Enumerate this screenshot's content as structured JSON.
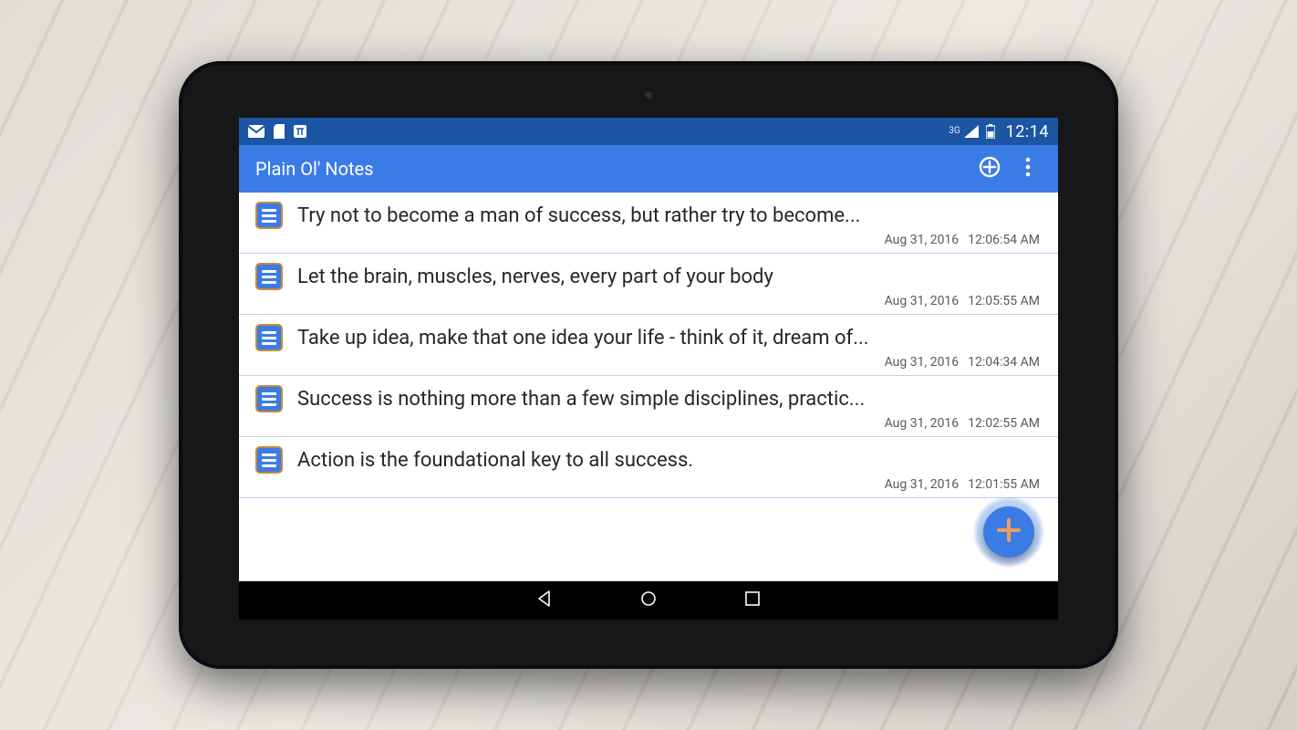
{
  "statusbar": {
    "network_label": "3G",
    "time": "12:14"
  },
  "appbar": {
    "title": "Plain Ol' Notes"
  },
  "notes": [
    {
      "title": "Try not to become a man of success, but rather try to become...",
      "date": "Aug 31, 2016",
      "time": "12:06:54 AM"
    },
    {
      "title": "Let the brain, muscles, nerves, every part of your body",
      "date": "Aug 31, 2016",
      "time": "12:05:55 AM"
    },
    {
      "title": "Take up idea, make that one idea your life -  think of it, dream of...",
      "date": "Aug 31, 2016",
      "time": "12:04:34 AM"
    },
    {
      "title": "Success is nothing more than a few simple disciplines, practic...",
      "date": "Aug 31, 2016",
      "time": "12:02:55 AM"
    },
    {
      "title": "Action is the foundational key to all success.",
      "date": "Aug 31, 2016",
      "time": "12:01:55 AM"
    }
  ]
}
